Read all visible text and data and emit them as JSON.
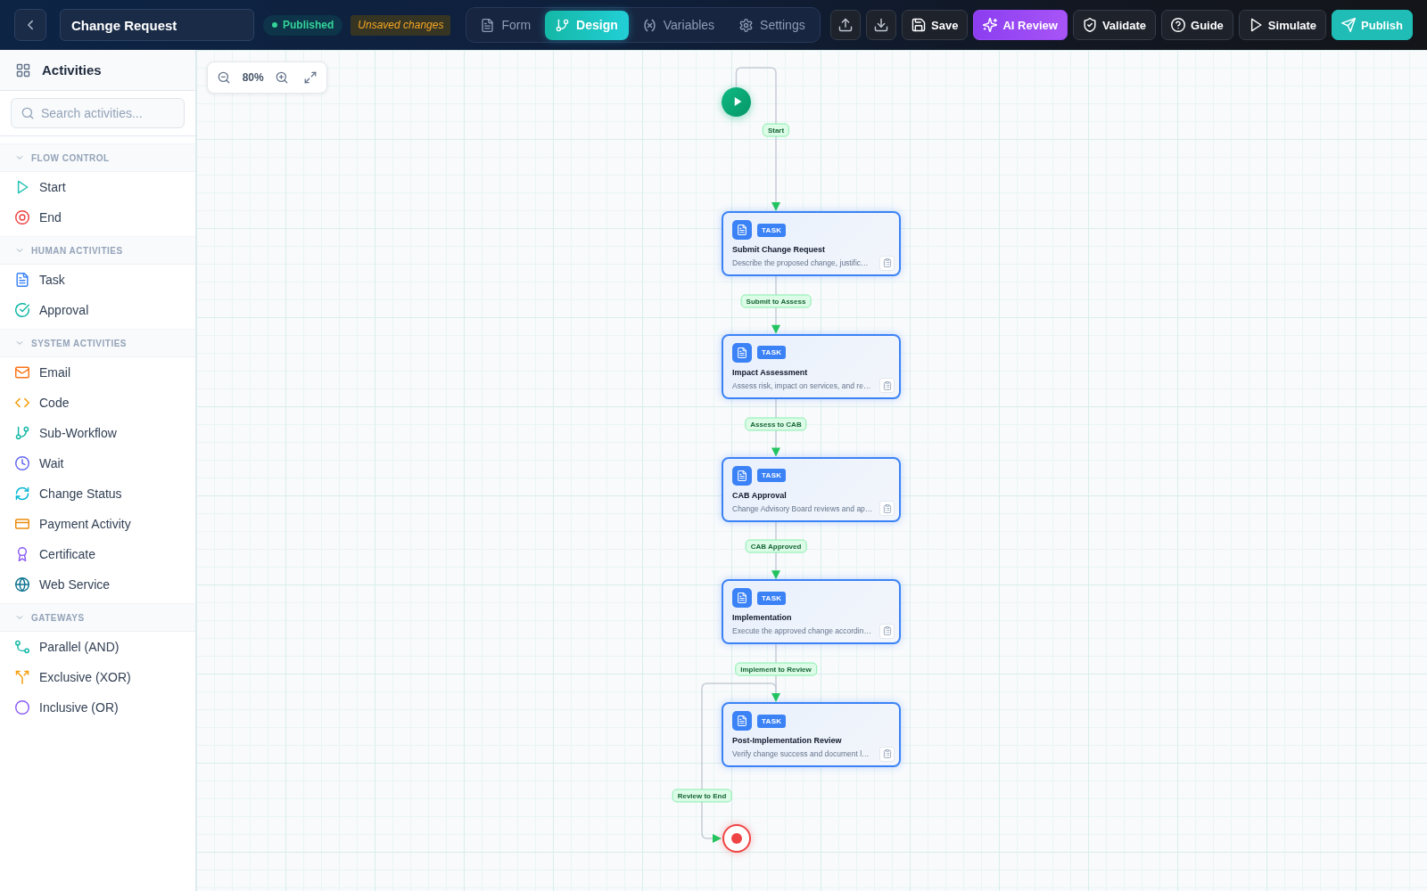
{
  "header": {
    "title": "Change Request",
    "status_badge": "Published",
    "unsaved_badge": "Unsaved changes",
    "tabs": [
      {
        "label": "Form",
        "kind": "form",
        "selected": false
      },
      {
        "label": "Design",
        "kind": "design",
        "selected": true
      },
      {
        "label": "Variables",
        "kind": "variables",
        "selected": false
      },
      {
        "label": "Settings",
        "kind": "settings",
        "selected": false
      }
    ],
    "actions": [
      {
        "kind": "upload"
      },
      {
        "kind": "download"
      },
      {
        "kind": "save",
        "label": "Save"
      },
      {
        "kind": "ai",
        "label": "AI Review"
      },
      {
        "kind": "validate",
        "label": "Validate"
      },
      {
        "kind": "guide",
        "label": "Guide"
      },
      {
        "kind": "simulate",
        "label": "Simulate"
      },
      {
        "kind": "publish",
        "label": "Publish"
      }
    ]
  },
  "sidebar": {
    "title": "Activities",
    "search": {
      "placeholder": "Search activities..."
    },
    "sections": [
      {
        "title": "FLOW CONTROL",
        "expanded": true,
        "items": [
          {
            "label": "Start",
            "kind": "start"
          },
          {
            "label": "End",
            "kind": "end"
          }
        ]
      },
      {
        "title": "HUMAN ACTIVITIES",
        "expanded": true,
        "items": [
          {
            "label": "Task",
            "kind": "task"
          },
          {
            "label": "Approval",
            "kind": "approval"
          }
        ]
      },
      {
        "title": "SYSTEM ACTIVITIES",
        "expanded": true,
        "items": [
          {
            "label": "Email",
            "kind": "email"
          },
          {
            "label": "Code",
            "kind": "code"
          },
          {
            "label": "Sub-Workflow",
            "kind": "subworkflow"
          },
          {
            "label": "Wait",
            "kind": "wait"
          },
          {
            "label": "Change Status",
            "kind": "status"
          },
          {
            "label": "Payment Activity",
            "kind": "payment"
          },
          {
            "label": "Certificate",
            "kind": "certificate"
          },
          {
            "label": "Web Service",
            "kind": "webservice"
          }
        ]
      },
      {
        "title": "GATEWAYS",
        "expanded": true,
        "items": [
          {
            "label": "Parallel (AND)",
            "kind": "parallel"
          },
          {
            "label": "Exclusive (XOR)",
            "kind": "exclusive"
          },
          {
            "label": "Inclusive (OR)",
            "kind": "inclusive"
          }
        ]
      }
    ]
  },
  "canvas": {
    "zoom_level": "80%",
    "nodes": [
      {
        "kind": "start"
      },
      {
        "kind": "task",
        "badge": "TASK",
        "title": "Submit Change Request",
        "description": "Describe the proposed change, justific…"
      },
      {
        "kind": "task",
        "badge": "TASK",
        "title": "Impact Assessment",
        "description": "Assess risk, impact on services, and re…"
      },
      {
        "kind": "task",
        "badge": "TASK",
        "title": "CAB Approval",
        "description": "Change Advisory Board reviews and ap…"
      },
      {
        "kind": "task",
        "badge": "TASK",
        "title": "Implementation",
        "description": "Execute the approved change accordin…"
      },
      {
        "kind": "task",
        "badge": "TASK",
        "title": "Post-Implementation Review",
        "description": "Verify change success and document l…"
      },
      {
        "kind": "end"
      }
    ],
    "edges": [
      {
        "label": "Start"
      },
      {
        "label": "Submit to Assess"
      },
      {
        "label": "Assess to CAB"
      },
      {
        "label": "CAB Approved"
      },
      {
        "label": "Implement to Review"
      },
      {
        "label": "Review to End"
      }
    ]
  }
}
